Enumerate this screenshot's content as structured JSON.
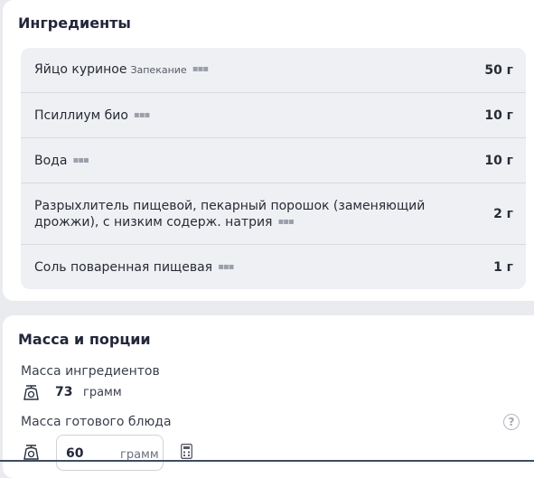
{
  "ingredients_section": {
    "title": "Ингредиенты",
    "items": [
      {
        "name": "Яйцо куриное",
        "tag": "Запекание",
        "amount": "50 г"
      },
      {
        "name": "Псиллиум био",
        "tag": "",
        "amount": "10 г"
      },
      {
        "name": "Вода",
        "tag": "",
        "amount": "10 г"
      },
      {
        "name": "Разрыхлитель пищевой, пекарный порошок (заменяющий дрожжи), с низким содерж. натрия",
        "tag": "",
        "amount": "2 г"
      },
      {
        "name": "Соль поваренная пищевая",
        "tag": "",
        "amount": "1 г"
      }
    ]
  },
  "mass_section": {
    "title": "Масса и порции",
    "ingredients_mass_label": "Масса ингредиентов",
    "ingredients_mass_value": "73",
    "ingredients_mass_unit": "грамм",
    "dish_mass_label": "Масса готового блюда",
    "dish_mass_value": "60",
    "dish_mass_unit": "грамм",
    "help_symbol": "?"
  },
  "icons": {
    "scale": "scale-icon",
    "more": "more-dots-icon",
    "help": "help-icon",
    "calculator": "calculator-icon"
  },
  "colors": {
    "background": "#e9ebee",
    "card": "#ffffff",
    "list_bg": "#eff0f3",
    "text": "#22273a"
  }
}
